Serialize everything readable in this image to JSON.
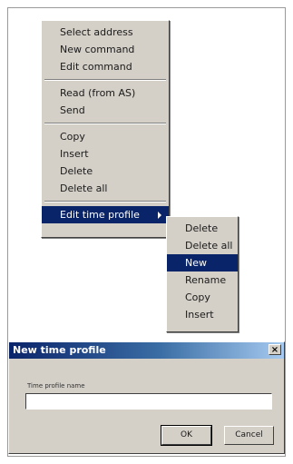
{
  "context_menu": {
    "items": [
      {
        "label": "Select address"
      },
      {
        "label": "New command"
      },
      {
        "label": "Edit command"
      },
      {
        "label": "Read (from AS)"
      },
      {
        "label": "Send"
      },
      {
        "label": "Copy"
      },
      {
        "label": "Insert"
      },
      {
        "label": "Delete"
      },
      {
        "label": "Delete all"
      },
      {
        "label": "Edit time profile"
      }
    ]
  },
  "submenu": {
    "items": [
      {
        "label": "Delete"
      },
      {
        "label": "Delete all"
      },
      {
        "label": "New"
      },
      {
        "label": "Rename"
      },
      {
        "label": "Copy"
      },
      {
        "label": "Insert"
      }
    ]
  },
  "dialog": {
    "title": "New time profile",
    "close_label": "×",
    "field_label": "Time profile name",
    "field_value": "",
    "ok_label": "OK",
    "cancel_label": "Cancel"
  },
  "colors": {
    "highlight": "#0a246a",
    "menu_bg": "#d4d0c8"
  }
}
